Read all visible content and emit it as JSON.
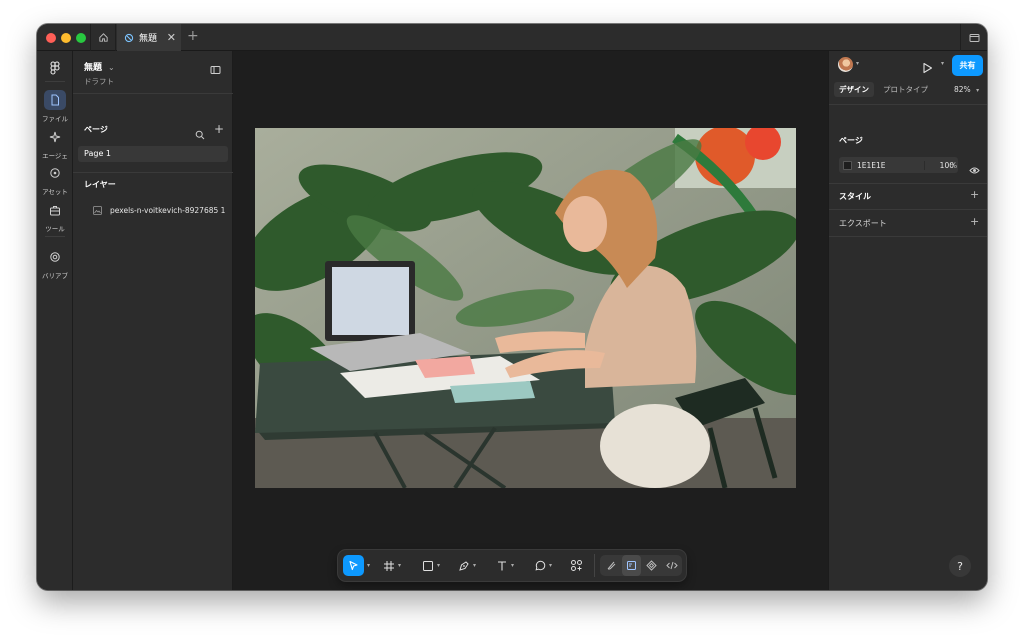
{
  "titlebar": {
    "file_tab_label": "無題",
    "close_glyph": "✕",
    "add_glyph": "+"
  },
  "rail": {
    "items": [
      {
        "label": "ファイル",
        "icon": "file-icon"
      },
      {
        "label": "エージェ",
        "icon": "agent-icon"
      },
      {
        "label": "アセット",
        "icon": "assets-icon"
      },
      {
        "label": "ツール",
        "icon": "tools-icon"
      },
      {
        "label": "バリアブ",
        "icon": "variables-icon"
      }
    ]
  },
  "left_panel": {
    "file_name": "無題",
    "file_sub": "ドラフト",
    "pages_heading": "ページ",
    "add_glyph": "+",
    "pages": [
      "Page 1"
    ],
    "layers_heading": "レイヤー",
    "layers": [
      "pexels-n-voitkevich-8927685 1"
    ]
  },
  "right_panel": {
    "share_label": "共有",
    "tabs": [
      "デザイン",
      "プロトタイプ"
    ],
    "zoom": "82%",
    "page_heading": "ページ",
    "page_fill_hex": "1E1E1E",
    "page_fill_opacity": "100",
    "page_fill_unit": "%",
    "styles_heading": "スタイル",
    "export_heading": "エクスポート",
    "add_glyph": "+",
    "help_glyph": "?"
  },
  "colors": {
    "accent": "#0d99ff",
    "canvas": "#1e1e1e",
    "panel": "#2c2c2c"
  }
}
